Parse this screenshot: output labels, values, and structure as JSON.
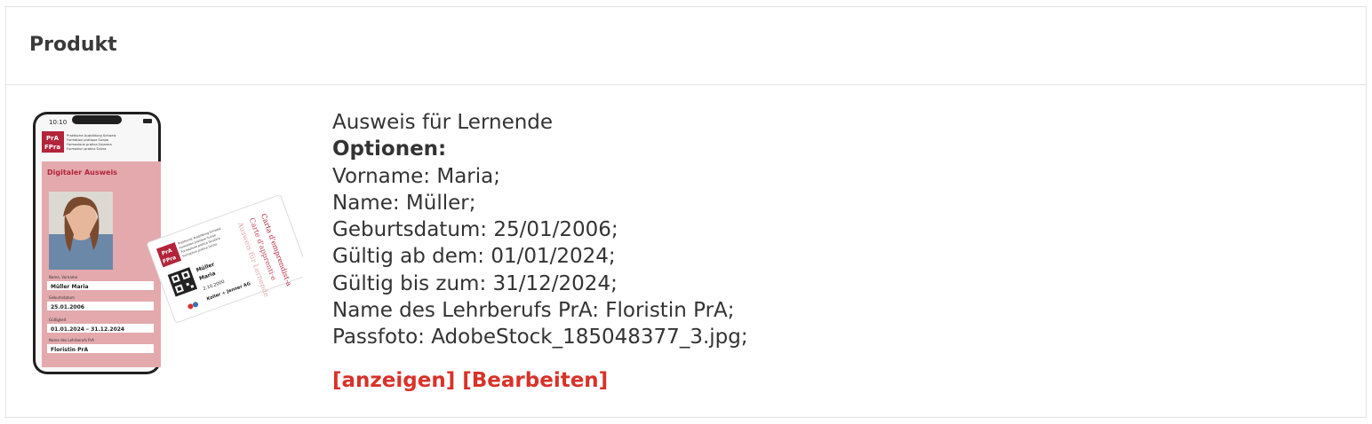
{
  "table": {
    "header": "Produkt"
  },
  "product": {
    "name": "Ausweis für Lernende",
    "options_label": "Optionen:",
    "options": [
      "Vorname: Maria;",
      "Name: Müller;",
      "Geburtsdatum: 25/01/2006;",
      "Gültig ab dem: 01/01/2024;",
      "Gültig bis zum: 31/12/2024;",
      "Name des Lehrberufs PrA: Floristin PrA;",
      "Passfoto: AdobeStock_185048377_3.jpg;"
    ],
    "actions": {
      "view": "[anzeigen]",
      "edit": "[Bearbeiten]"
    }
  },
  "thumbnail": {
    "phone": {
      "time": "10:10",
      "logo_line1": "PrA",
      "logo_line2": "FPra",
      "org_lines": [
        "Praktische Ausbildung Schweiz",
        "Formation pratique Suisse",
        "Formazione pratica Svizzera",
        "Furmaziun pratica Svizra"
      ],
      "card_title": "Digitaler Ausweis",
      "field1_label": "Name, Vorname",
      "field1_value": "Müller Maria",
      "field2_label": "Geburtsdatum",
      "field2_value": "25.01.2006",
      "field3_label": "Gültigkeit",
      "field3_value": "01.01.2024 – 31.12.2024",
      "field4_label": "Name des Lehrberufs PrA",
      "field4_value": "Floristin PrA"
    },
    "card": {
      "logo_line1": "PrA",
      "logo_line2": "FPra",
      "org_lines": [
        "Praktische Ausbildung Schweiz",
        "Formation pratique Suisse",
        "Formazione pratica Svizzera",
        "Furmaziun pratica Svizra"
      ],
      "name": "Müller",
      "first_name": "Maria",
      "date": "2.10.2000",
      "company": "Koller + Jenner AG",
      "side1": "Ausweis für Lernende",
      "side2": "Carte d'apprenti·e",
      "side3": "Carta d'emprendist-a"
    },
    "colors": {
      "brand_red": "#b3243b",
      "card_pink": "#e3a9ad",
      "link_red": "#d8322a"
    }
  }
}
